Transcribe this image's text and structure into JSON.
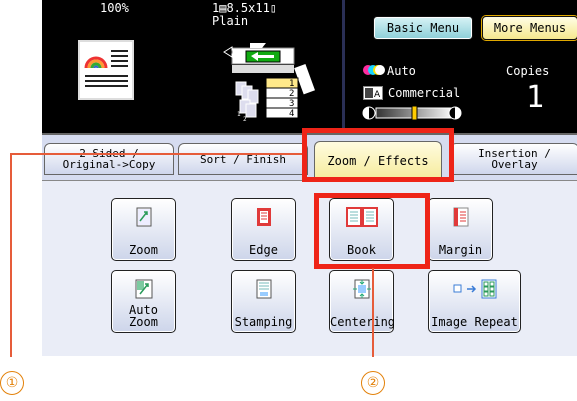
{
  "status": {
    "zoom": "100%",
    "paper_info": "1▤8.5x11▯",
    "paper_type": "Plain",
    "tray_numbers": [
      "1",
      "2",
      "3",
      "4"
    ],
    "color_mode": "Auto",
    "original_type": "Commercial",
    "copies_label": "Copies",
    "copies_value": "1"
  },
  "menu": {
    "basic_label": "Basic Menu",
    "more_label": "More Menus"
  },
  "tabs": [
    {
      "line1": "2-Sided /",
      "line2": "Original->Copy"
    },
    {
      "line1": "Sort / Finish",
      "line2": ""
    },
    {
      "line1": "Zoom / Effects",
      "line2": ""
    },
    {
      "line1": "Insertion /",
      "line2": "Overlay"
    }
  ],
  "functions": [
    {
      "label": "Zoom",
      "icon": "zoom-icon"
    },
    {
      "label": "Edge",
      "icon": "edge-icon"
    },
    {
      "label": "Book",
      "icon": "book-icon"
    },
    {
      "label": "Margin",
      "icon": "margin-icon"
    },
    {
      "label": "Auto Zoom",
      "icon": "auto-zoom-icon"
    },
    {
      "label": "Stamping",
      "icon": "stamping-icon"
    },
    {
      "label": "Centering",
      "icon": "centering-icon"
    },
    {
      "label": "Image Repeat",
      "icon": "image-repeat-icon"
    }
  ],
  "callouts": [
    "①",
    "②"
  ],
  "colors": {
    "highlight": "#ee2418",
    "active_tab": "#f6ec9a",
    "callout": "#e3820b"
  }
}
